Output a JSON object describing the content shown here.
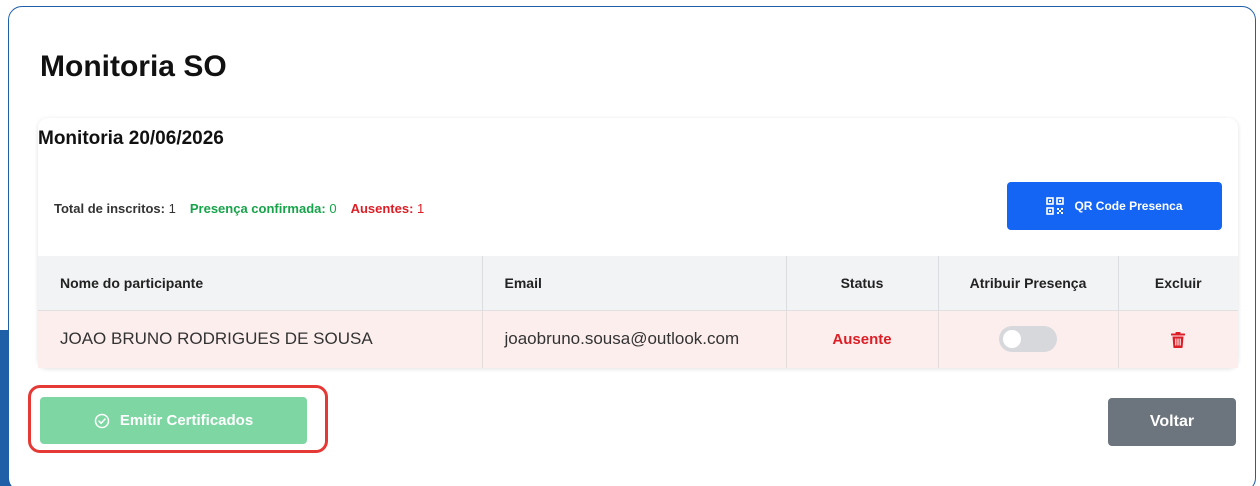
{
  "page": {
    "title": "Monitoria SO",
    "session_title": "Monitoria 20/06/2026"
  },
  "stats": {
    "total_label": "Total de inscritos:",
    "total_value": "1",
    "confirmed_label": "Presença confirmada:",
    "confirmed_value": "0",
    "absent_label": "Ausentes:",
    "absent_value": "1"
  },
  "qr_button": {
    "label": "QR Code Presenca",
    "icon": "qr-code-icon"
  },
  "table": {
    "headers": [
      "Nome do participante",
      "Email",
      "Status",
      "Atribuir Presença",
      "Excluir"
    ],
    "rows": [
      {
        "name": "JOAO BRUNO RODRIGUES DE SOUSA",
        "email": "joaobruno.sousa@outlook.com",
        "status": "Ausente",
        "presence_toggle": false,
        "delete_icon": "trash-icon"
      }
    ]
  },
  "actions": {
    "emit_certificates_label": "Emitir Certificados",
    "emit_certificates_icon": "check-circle-icon",
    "back_label": "Voltar"
  },
  "colors": {
    "primary": "#1565f5",
    "success": "#7ed7a3",
    "danger": "#dc1f26",
    "secondary": "#6c757d",
    "frame": "#1f5fa8",
    "highlight": "#e53935"
  }
}
